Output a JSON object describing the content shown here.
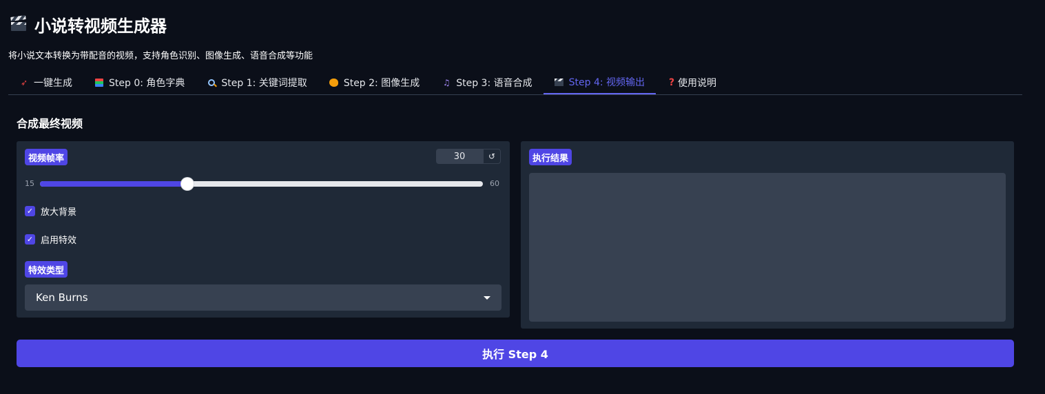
{
  "app": {
    "title": "小说转视频生成器",
    "subtitle": "将小说文本转换为带配音的视频，支持角色识别、图像生成、语音合成等功能"
  },
  "tabs": [
    {
      "label": "一键生成",
      "icon": "rocket-icon"
    },
    {
      "label": "Step 0: 角色字典",
      "icon": "books-icon"
    },
    {
      "label": "Step 1: 关键词提取",
      "icon": "magnifier-icon"
    },
    {
      "label": "Step 2: 图像生成",
      "icon": "palette-icon"
    },
    {
      "label": "Step 3: 语音合成",
      "icon": "music-note-icon"
    },
    {
      "label": "Step 4: 视频输出",
      "icon": "clapper-icon",
      "active": true
    },
    {
      "label": "使用说明",
      "icon": "question-icon"
    }
  ],
  "section": {
    "title": "合成最终视频"
  },
  "fps": {
    "label": "视频帧率",
    "value": "30",
    "min": "15",
    "max": "60",
    "fraction": 0.3333,
    "reset_symbol": "↺"
  },
  "options": {
    "zoom_background": {
      "label": "放大背景",
      "checked": true
    },
    "enable_effects": {
      "label": "启用特效",
      "checked": true
    }
  },
  "effect_type": {
    "label": "特效类型",
    "selected": "Ken Burns"
  },
  "result": {
    "label": "执行结果",
    "value": ""
  },
  "run_button": {
    "label": "执行 Step 4"
  },
  "colors": {
    "accent": "#4f46e5",
    "background": "#0b0f19",
    "panel": "#1f2937",
    "input": "#374151"
  }
}
